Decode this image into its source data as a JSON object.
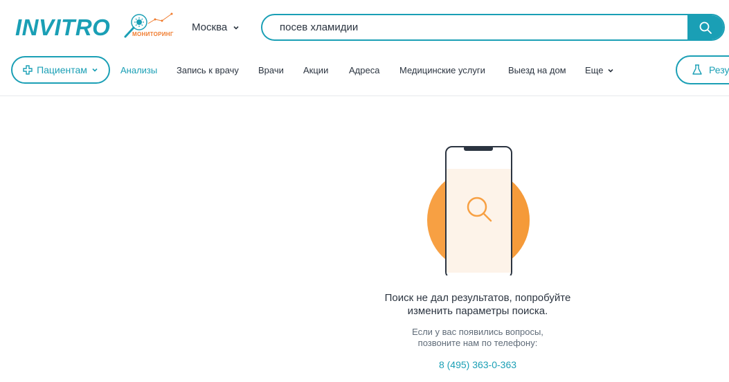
{
  "header": {
    "logo_text": "INVITRO",
    "monitoring_label": "МОНИТОРИНГ",
    "city": "Москва",
    "search": {
      "value": "посев хламидии",
      "placeholder": ""
    }
  },
  "nav": {
    "patients_label": "Пациентам",
    "items": [
      {
        "label": "Анализы"
      },
      {
        "label": "Запись к врачу"
      },
      {
        "label": "Врачи"
      },
      {
        "label": "Акции"
      },
      {
        "label": "Адреса"
      },
      {
        "label": "Медицинские услуги"
      },
      {
        "label": "Выезд на дом"
      }
    ],
    "more_label": "Еще",
    "results_label": "Резу"
  },
  "empty_state": {
    "message_line1": "Поиск не дал результатов, попробуйте",
    "message_line2": "изменить параметры поиска.",
    "sub_line1": "Если у вас появились вопросы,",
    "sub_line2": "позвоните нам по телефону:",
    "phone": "8 (495) 363-0-363"
  },
  "colors": {
    "brand": "#1a9fb5",
    "accent": "#f07b2d",
    "circle": "#f7a043"
  },
  "icons": [
    "search-icon",
    "plus-icon",
    "chevron-down-icon",
    "flask-icon",
    "magnifier-illustration"
  ]
}
